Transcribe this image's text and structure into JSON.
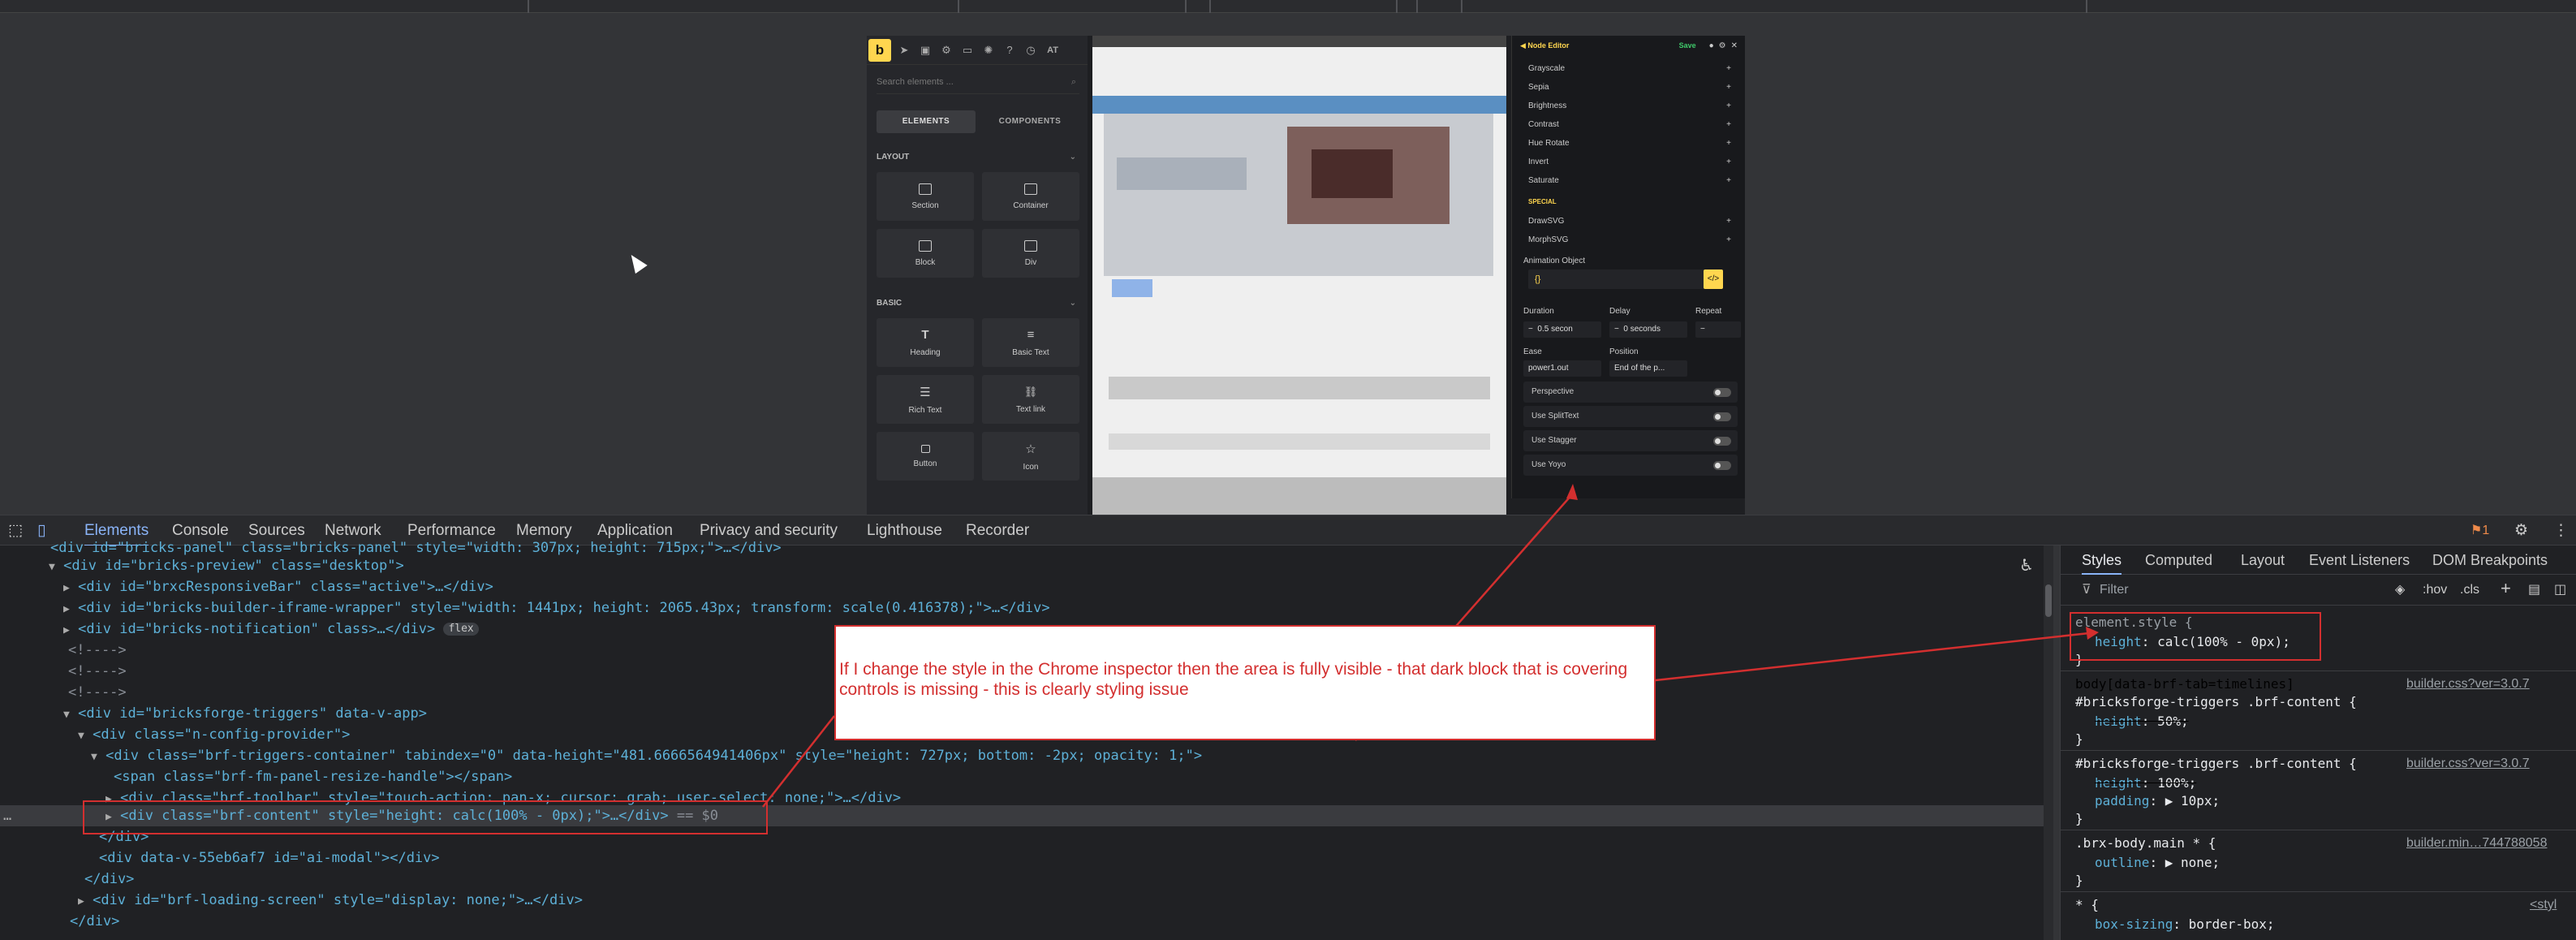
{
  "builder": {
    "logo": "b",
    "toolbar_right": "AT",
    "search_placeholder": "Search elements ...",
    "tabs": [
      "ELEMENTS",
      "COMPONENTS"
    ],
    "layout_section": "LAYOUT",
    "basic_section": "BASIC",
    "layout_items": [
      "Section",
      "Container",
      "Block",
      "Div"
    ],
    "basic_items": [
      "Heading",
      "Basic Text",
      "Rich Text",
      "Text link",
      "Button",
      "Icon"
    ]
  },
  "node_editor": {
    "title": "Node Editor",
    "save_label": "Save",
    "filter_rows": [
      "Grayscale",
      "Sepia",
      "Brightness",
      "Contrast",
      "Hue Rotate",
      "Invert",
      "Saturate"
    ],
    "special_label": "SPECIAL",
    "special_rows": [
      "DrawSVG",
      "MorphSVG"
    ],
    "animation_object_label": "Animation Object",
    "animation_object_value": "{}",
    "duration_label": "Duration",
    "duration_value": "0.5 secon",
    "delay_label": "Delay",
    "delay_value": "0 seconds",
    "repeat_label": "Repeat",
    "ease_label": "Ease",
    "ease_value": "power1.out",
    "position_label": "Position",
    "position_value": "End of the p...",
    "toggles": [
      "Perspective",
      "Use SplitText",
      "Use Stagger",
      "Use Yoyo"
    ]
  },
  "devtools": {
    "tabs": [
      "Elements",
      "Console",
      "Sources",
      "Network",
      "Performance",
      "Memory",
      "Application",
      "Privacy and security",
      "Lighthouse",
      "Recorder"
    ],
    "issues_count": "1",
    "dom": {
      "l0": "<div id=\"bricks-panel\" class=\"bricks-panel\" style=\"width: 307px; height: 715px;\">…</div>",
      "l1": "<div id=\"bricks-preview\" class=\"desktop\">",
      "l2": "<div id=\"brxcResponsiveBar\" class=\"active\">…</div>",
      "l3": "<div id=\"bricks-builder-iframe-wrapper\" style=\"width: 1441px; height: 2065.43px; transform: scale(0.416378);\">…</div>",
      "l4": "<div id=\"bricks-notification\" class>…</div>",
      "l4_pill": "flex",
      "l5": "<!---->",
      "l6": "<!---->",
      "l7": "<!---->",
      "l8": "<div id=\"bricksforge-triggers\" data-v-app>",
      "l9": "<div class=\"n-config-provider\">",
      "l10": "<div class=\"brf-triggers-container\" tabindex=\"0\" data-height=\"481.6666564941406px\" style=\"height: 727px; bottom: -2px; opacity: 1;\">",
      "l11": "<span class=\"brf-fm-panel-resize-handle\"></span>",
      "l12": "<div class=\"brf-toolbar\" style=\"touch-action: pan-x; cursor: grab; user-select: none;\">…</div>",
      "l13": "<div class=\"brf-content\" style=\"height: calc(100% - 0px);\">…</div>",
      "l13_suffix": "== $0",
      "l14": "</div>",
      "l15": "<div data-v-55eb6af7 id=\"ai-modal\"></div>",
      "l16": "</div>",
      "l17": "<div id=\"brf-loading-screen\" style=\"display: none;\">…</div>",
      "l18": "</div>"
    }
  },
  "styles_panel": {
    "tabs": [
      "Styles",
      "Computed",
      "Layout",
      "Event Listeners",
      "DOM Breakpoints"
    ],
    "filter_placeholder": "Filter",
    "hov": ":hov",
    "cls": ".cls",
    "rules": [
      {
        "selector": "element.style {",
        "prop": "height",
        "value": "calc(100% - 0px);",
        "source": ""
      },
      {
        "selector": "body[data-brf-tab=timelines]",
        "selector2": "#bricksforge-triggers .brf-content {",
        "prop": "height",
        "value": "50%;",
        "source": "builder.css?ver=3.0.7"
      },
      {
        "selector": "#bricksforge-triggers .brf-content {",
        "prop": "height",
        "value": "100%;",
        "prop2": "padding",
        "value2": "▶ 10px;",
        "source": "builder.css?ver=3.0.7"
      },
      {
        "selector": ".brx-body.main * {",
        "prop": "outline",
        "value": "▶ none;",
        "source": "builder.min…744788058"
      },
      {
        "selector": "* {",
        "prop": "box-sizing",
        "value": "border-box;",
        "source": "<styl"
      }
    ]
  },
  "annotation": {
    "text": "If I change the style in the Chrome inspector then the area is fully visible - that dark block that is covering controls is missing - this is clearly styling issue"
  },
  "colors": {
    "annotation_red": "#d32f2f",
    "bricks_yellow": "#ffd64f",
    "devtools_blue": "#8ab4f8"
  }
}
